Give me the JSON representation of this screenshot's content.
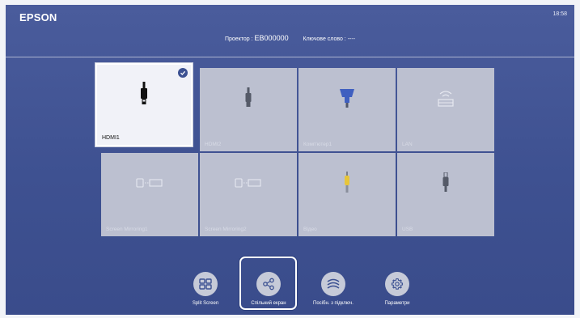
{
  "header": {
    "brand": "EPSON",
    "clock": "18:58",
    "projector_label": "Проектор :",
    "projector_id": "EB000000",
    "keyword_label": "Ключове слово :",
    "keyword_value": "----"
  },
  "sources": [
    {
      "label": "HDMI1",
      "icon": "hdmi-plug-icon",
      "selected": true
    },
    {
      "label": "HDMI2",
      "icon": "hdmi-plug-icon",
      "selected": false
    },
    {
      "label": "Комп'ютер1",
      "icon": "vga-connector-icon",
      "selected": false
    },
    {
      "label": "LAN",
      "icon": "lan-network-icon",
      "selected": false
    },
    {
      "label": "Screen Mirroring1",
      "icon": "screen-mirroring-icon",
      "selected": false
    },
    {
      "label": "Screen Mirroring2",
      "icon": "screen-mirroring-icon",
      "selected": false
    },
    {
      "label": "Відео",
      "icon": "rca-video-icon",
      "selected": false
    },
    {
      "label": "USB",
      "icon": "usb-plug-icon",
      "selected": false
    }
  ],
  "dock": [
    {
      "label": "Split Screen",
      "icon": "split-screen-icon"
    },
    {
      "label": "Спільний екран",
      "icon": "share-icon",
      "focused": true
    },
    {
      "label": "Посібн. з підключ.",
      "icon": "connection-guide-icon"
    },
    {
      "label": "Параметри",
      "icon": "gear-icon"
    }
  ],
  "colors": {
    "background": "#3e5191",
    "tile": "#bcc0d0",
    "tile_selected": "#f1f2f8",
    "accent": "#3c5192"
  }
}
